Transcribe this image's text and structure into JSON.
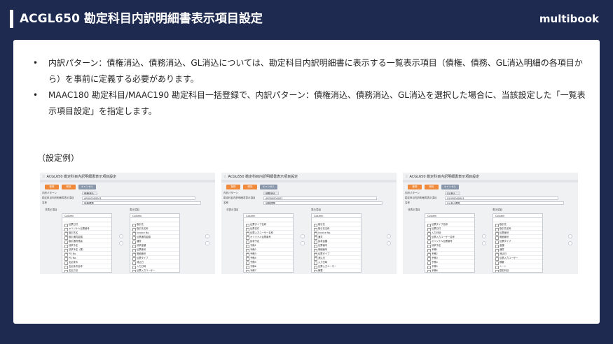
{
  "header": {
    "title": "ACGL650 勘定科目内訳明細書表示項目設定",
    "logo": "multibook"
  },
  "bullets": [
    "内訳パターン：債権消込、債務消込、GL消込については、勘定科目内訳明細書に表示する一覧表示項目（債権、債務、GL消込明細の各項目から）を事前に定義する必要があります。",
    "MAAC180 勘定科目/MAAC190 勘定科目一括登録で、内訳パターン：債権消込、債務消込、GL消込を選択した場合に、当該設定した「一覧表示項目設定」を指定します。"
  ],
  "example_label": "（設定例）",
  "screenshots": [
    {
      "title": "ACGL650 勘定科目内訳明細書表示項目設定",
      "buttons": {
        "register": "登録",
        "delete": "削除",
        "cancel": "キャンセル"
      },
      "pattern_label": "内訳パターン",
      "pattern_value": "債権消込",
      "setting_label": "勘定科目内訳明細書表示項目",
      "setting_value": "AR000000001",
      "name_label": "名称",
      "name_value": "債権標準",
      "left_header": "非表示項目",
      "right_header": "表示項目",
      "column_select": "Column",
      "left_items": [
        "伝票日付",
        "オリジナル伝票番号",
        "取引先名",
        "取引通貨金額",
        "取引通貨残高",
        "請求予定",
        "請求予定（累）",
        "PO No.",
        "PO No.",
        "支払条件",
        "支払条件名称",
        "支払方法"
      ],
      "right_items": [
        "取引先",
        "取引先名称",
        "Invoice No.",
        "伝票通貨金額",
        "通貨",
        "請求金額",
        "伝票番号",
        "明細番号",
        "伝票タイプ",
        "消込日",
        "入力日時",
        "伝票入力ユーザー"
      ]
    },
    {
      "title": "ACGL650 勘定科目内訳明細書表示項目設定",
      "buttons": {
        "register": "登録",
        "delete": "削除",
        "cancel": "キャンセル"
      },
      "pattern_label": "内訳パターン",
      "pattern_value": "債務消込",
      "setting_label": "勘定科目内訳明細書表示項目",
      "setting_value": "AP000000001",
      "name_label": "名称",
      "name_value": "債務標準",
      "left_header": "非表示項目",
      "right_header": "表示項目",
      "column_select": "Column",
      "left_items": [
        "伝票タイプ名称",
        "伝票日付",
        "伝票入力ユーザー名称",
        "オリジナル伝票番号",
        "請求予定",
        "予備1",
        "予備2",
        "予備3",
        "予備4",
        "予備5",
        "予備6",
        "予備7"
      ],
      "right_items": [
        "取引先",
        "取引先名称",
        "Invoice No.",
        "通貨",
        "請求金額",
        "伝票番号",
        "明細番号",
        "伝票タイプ",
        "消込日",
        "入力日時",
        "伝票入力ユーザー",
        "摘要"
      ]
    },
    {
      "title": "ACGL650 勘定科目内訳明細書表示項目設定",
      "buttons": {
        "register": "登録",
        "delete": "削除",
        "cancel": "キャンセル"
      },
      "pattern_label": "内訳パターン",
      "pattern_value": "GL消込",
      "setting_label": "勘定科目内訳明細書表示項目",
      "setting_value": "GL000000001",
      "name_label": "名称",
      "name_value": "GL消込標準",
      "left_header": "非表示項目",
      "right_header": "表示項目",
      "column_select": "Column",
      "left_items": [
        "伝票タイプ名称",
        "伝票日付",
        "入力日時",
        "伝票入力ユーザー名称",
        "オリジナル伝票番号",
        "請求予定",
        "予備1",
        "予備2",
        "予備3",
        "予備4",
        "予備5",
        "予備6"
      ],
      "right_items": [
        "取引先",
        "取引先名称",
        "伝票番号",
        "明細番号",
        "伝票タイプ",
        "金額",
        "通貨",
        "消込日",
        "伝票入力ユーザー",
        "摘要",
        "シート",
        "勘定科目"
      ]
    }
  ]
}
